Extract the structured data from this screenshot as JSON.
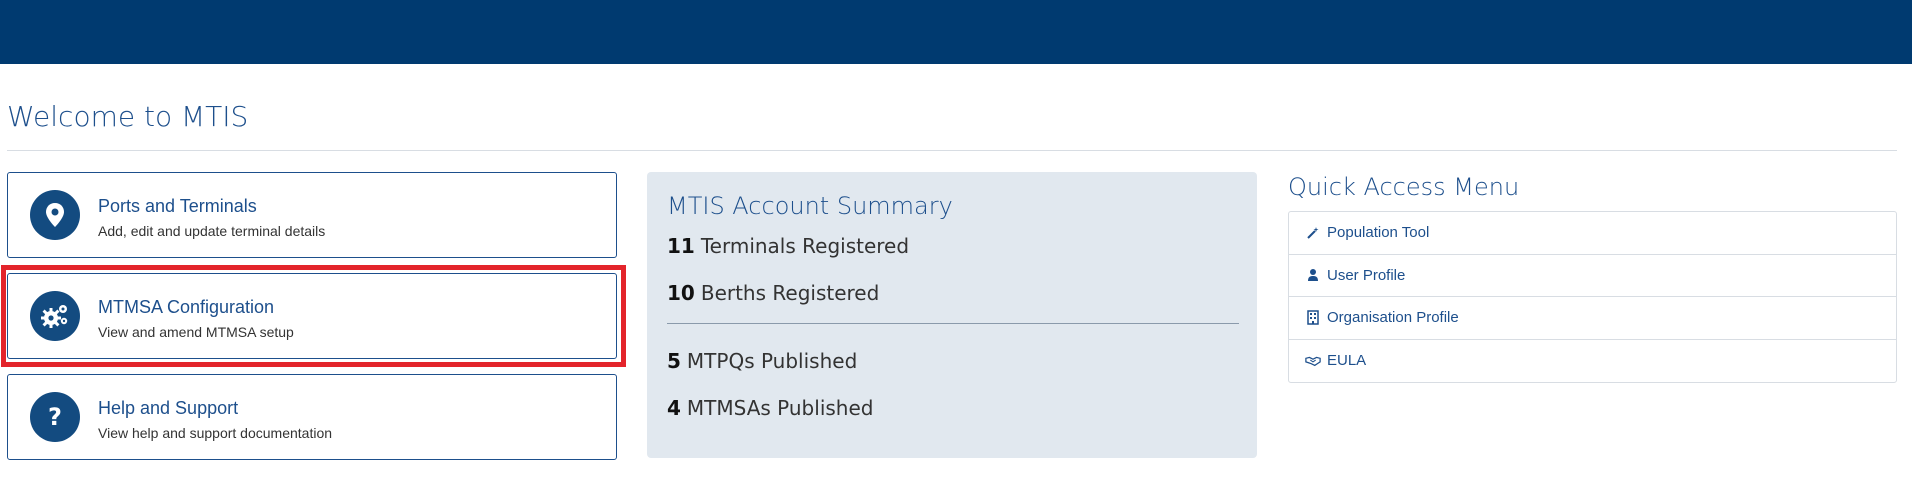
{
  "page": {
    "title": "Welcome to MTIS"
  },
  "tiles": [
    {
      "title": "Ports and Terminals",
      "description": "Add, edit and update terminal details",
      "icon": "map-marker-icon"
    },
    {
      "title": "MTMSA Configuration",
      "description": "View and amend MTMSA setup",
      "icon": "cogs-icon"
    },
    {
      "title": "Help and Support",
      "description": "View help and support documentation",
      "icon": "question-icon"
    }
  ],
  "summary": {
    "title": "MTIS Account Summary",
    "stats": [
      {
        "value": "11",
        "label": "Terminals Registered"
      },
      {
        "value": "10",
        "label": "Berths Registered"
      },
      {
        "value": "5",
        "label": "MTPQs Published"
      },
      {
        "value": "4",
        "label": "MTMSAs Published"
      }
    ]
  },
  "quick_access": {
    "title": "Quick Access Menu",
    "items": [
      {
        "label": "Population Tool",
        "icon": "magic-wand-icon"
      },
      {
        "label": "User Profile",
        "icon": "user-icon"
      },
      {
        "label": "Organisation Profile",
        "icon": "building-icon"
      },
      {
        "label": "EULA",
        "icon": "handshake-icon"
      }
    ]
  },
  "colors": {
    "header": "#003a70",
    "primary_text": "#1d4f8c",
    "icon_circle": "#134b80",
    "summary_bg": "#e1e8ef",
    "highlight": "#e3242b"
  }
}
